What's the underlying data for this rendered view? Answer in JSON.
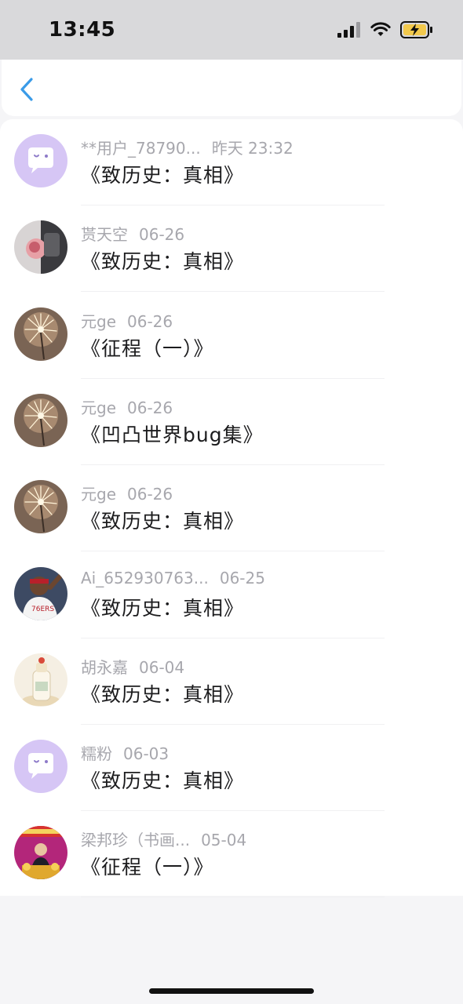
{
  "status_bar": {
    "time": "13:45"
  },
  "items": [
    {
      "user": "**用户_78790...",
      "date": "昨天 23:32",
      "title": "《致历史：真相》",
      "avatar": "default-avatar"
    },
    {
      "user": "贳天空",
      "date": "06-26",
      "title": "《致历史：真相》",
      "avatar": "photo-avatar-rose"
    },
    {
      "user": "元ge",
      "date": "06-26",
      "title": "《征程（一）》",
      "avatar": "photo-avatar-sparkler"
    },
    {
      "user": "元ge",
      "date": "06-26",
      "title": "《凹凸世界bug集》",
      "avatar": "photo-avatar-sparkler"
    },
    {
      "user": "元ge",
      "date": "06-26",
      "title": "《致历史：真相》",
      "avatar": "photo-avatar-sparkler"
    },
    {
      "user": "Ai_652930763...",
      "date": "06-25",
      "title": "《致历史：真相》",
      "avatar": "photo-avatar-basketball"
    },
    {
      "user": "胡永嘉",
      "date": "06-04",
      "title": "《致历史：真相》",
      "avatar": "photo-avatar-bottle"
    },
    {
      "user": "糯粉",
      "date": "06-03",
      "title": "《致历史：真相》",
      "avatar": "default-avatar"
    },
    {
      "user": "梁邦珍（书画...",
      "date": "05-04",
      "title": "《征程（一）》",
      "avatar": "photo-avatar-event"
    }
  ],
  "colors": {
    "accent": "#3a9be8",
    "default_avatar_bg": "#d6c6f5"
  }
}
